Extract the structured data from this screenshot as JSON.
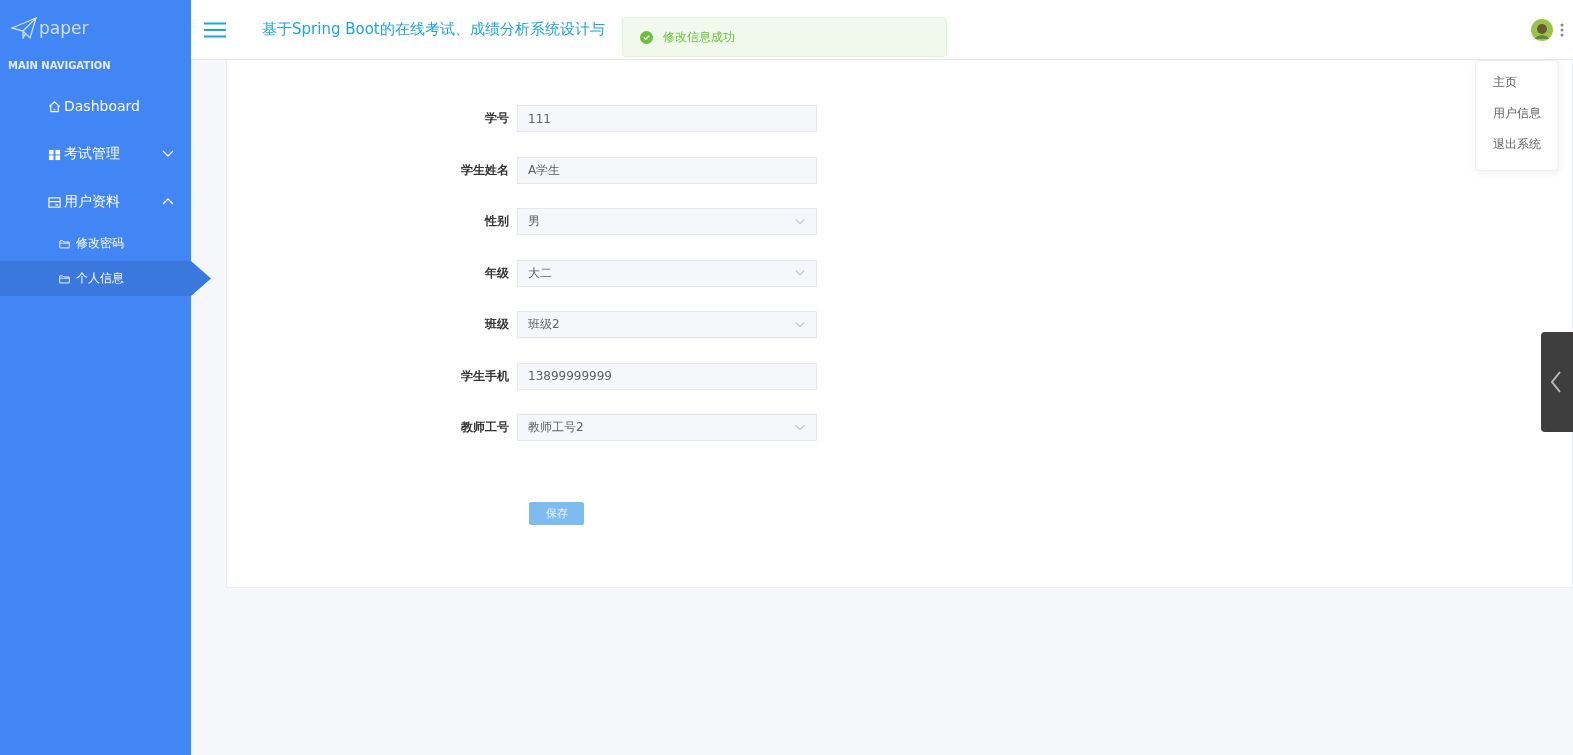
{
  "sidebar": {
    "logo": "paper",
    "section_title": "MAIN NAVIGATION",
    "items": [
      {
        "label": "Dashboard",
        "kind": "home",
        "selected": false
      },
      {
        "label": "考试管理",
        "kind": "grid",
        "selected": false,
        "expanded": false
      },
      {
        "label": "用户资料",
        "kind": "card",
        "selected": false,
        "expanded": true,
        "children": [
          {
            "label": "修改密码",
            "kind": "folder",
            "selected": false
          },
          {
            "label": "个人信息",
            "kind": "folder",
            "selected": true
          }
        ]
      }
    ]
  },
  "header": {
    "title": "基于Spring Boot的在线考试、成绩分析系统设计与"
  },
  "toast": {
    "message": "修改信息成功"
  },
  "user_menu": {
    "items": [
      "主页",
      "用户信息",
      "退出系统"
    ]
  },
  "form": {
    "fields": [
      {
        "label": "学号",
        "kind": "input",
        "value": "111"
      },
      {
        "label": "学生姓名",
        "kind": "input",
        "value": "A学生"
      },
      {
        "label": "性别",
        "kind": "select",
        "value": "男"
      },
      {
        "label": "年级",
        "kind": "select",
        "value": "大二"
      },
      {
        "label": "班级",
        "kind": "select",
        "value": "班级2"
      },
      {
        "label": "学生手机",
        "kind": "input",
        "value": "13899999999"
      },
      {
        "label": "教师工号",
        "kind": "select",
        "value": "教师工号2"
      }
    ],
    "save_button": "保存"
  }
}
